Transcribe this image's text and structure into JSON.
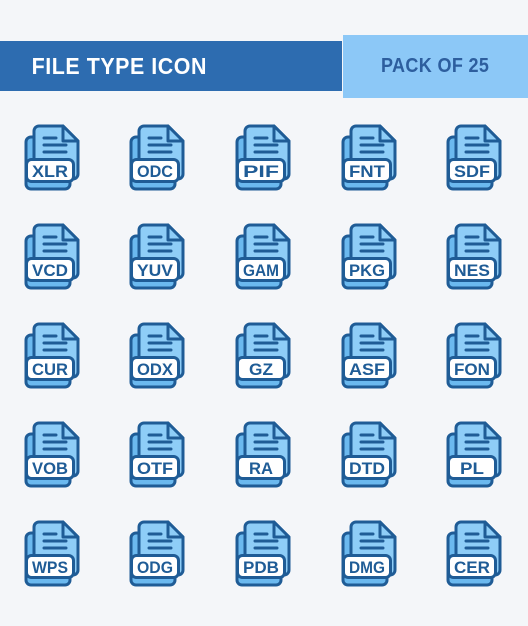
{
  "page": {
    "background_color": "#f4f6f9"
  },
  "header": {
    "title": "FILE TYPE ICON",
    "pack_label": "PACK OF 25",
    "title_bar_color": "#2d6cb0",
    "pack_bar_color": "#8cc8f7",
    "title_text_color": "#ffffff",
    "pack_text_color": "#2d5e9e"
  },
  "palette": {
    "page_fill": "#8ecdf7",
    "page_stroke": "#1f5c96",
    "back_page_fill": "#6bb9ef",
    "label_fill": "#ffffff",
    "label_stroke": "#1f5c96",
    "ext_text_color": "#1f5c96",
    "line_color": "#1f5c96"
  },
  "grid": {
    "columns": 5,
    "rows": 5,
    "total_icons": 25,
    "icons": [
      {
        "ext": "XLR"
      },
      {
        "ext": "ODC"
      },
      {
        "ext": "PIF"
      },
      {
        "ext": "FNT"
      },
      {
        "ext": "SDF"
      },
      {
        "ext": "VCD"
      },
      {
        "ext": "YUV"
      },
      {
        "ext": "GAM"
      },
      {
        "ext": "PKG"
      },
      {
        "ext": "NES"
      },
      {
        "ext": "CUR"
      },
      {
        "ext": "ODX"
      },
      {
        "ext": "GZ"
      },
      {
        "ext": "ASF"
      },
      {
        "ext": "FON"
      },
      {
        "ext": "VOB"
      },
      {
        "ext": "OTF"
      },
      {
        "ext": "RA"
      },
      {
        "ext": "DTD"
      },
      {
        "ext": "PL"
      },
      {
        "ext": "WPS"
      },
      {
        "ext": "ODG"
      },
      {
        "ext": "PDB"
      },
      {
        "ext": "DMG"
      },
      {
        "ext": "CER"
      }
    ]
  }
}
